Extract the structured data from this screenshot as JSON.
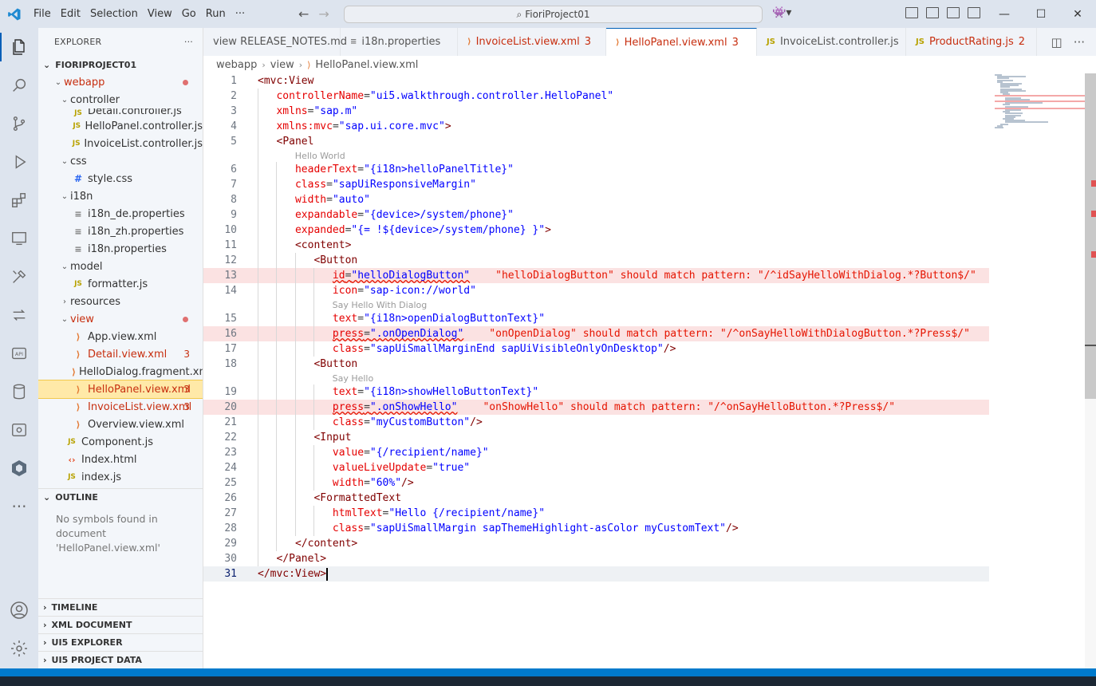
{
  "titlebar": {
    "menu": [
      "File",
      "Edit",
      "Selection",
      "View",
      "Go",
      "Run",
      "···"
    ],
    "search_text": "FioriProject01",
    "controls": {
      "minimize": "—",
      "maximize": "☐",
      "close": "✕"
    }
  },
  "explorer": {
    "title": "EXPLORER",
    "more": "···",
    "project": "FIORIPROJECT01",
    "tree": [
      {
        "label": "webapp",
        "type": "folder",
        "depth": 1,
        "error": true,
        "dot": true
      },
      {
        "label": "controller",
        "type": "folder",
        "depth": 2
      },
      {
        "label": "Detail.controller.js",
        "type": "js",
        "depth": 3,
        "partial": true
      },
      {
        "label": "HelloPanel.controller.js",
        "type": "js",
        "depth": 3
      },
      {
        "label": "InvoiceList.controller.js",
        "type": "js",
        "depth": 3
      },
      {
        "label": "css",
        "type": "folder",
        "depth": 2
      },
      {
        "label": "style.css",
        "type": "css",
        "depth": 3
      },
      {
        "label": "i18n",
        "type": "folder",
        "depth": 2
      },
      {
        "label": "i18n_de.properties",
        "type": "prop",
        "depth": 3
      },
      {
        "label": "i18n_zh.properties",
        "type": "prop",
        "depth": 3
      },
      {
        "label": "i18n.properties",
        "type": "prop",
        "depth": 3
      },
      {
        "label": "model",
        "type": "folder",
        "depth": 2
      },
      {
        "label": "formatter.js",
        "type": "js",
        "depth": 3
      },
      {
        "label": "resources",
        "type": "folder",
        "depth": 2,
        "collapsed": true
      },
      {
        "label": "view",
        "type": "folder",
        "depth": 2,
        "error": true,
        "dot": true
      },
      {
        "label": "App.view.xml",
        "type": "xml",
        "depth": 3
      },
      {
        "label": "Detail.view.xml",
        "type": "xml",
        "depth": 3,
        "error": true,
        "badge": "3"
      },
      {
        "label": "HelloDialog.fragment.xml",
        "type": "xml",
        "depth": 3
      },
      {
        "label": "HelloPanel.view.xml",
        "type": "xml",
        "depth": 3,
        "error": true,
        "badge": "3",
        "selected": true
      },
      {
        "label": "InvoiceList.view.xml",
        "type": "xml",
        "depth": 3,
        "error": true,
        "badge": "3"
      },
      {
        "label": "Overview.view.xml",
        "type": "xml",
        "depth": 3
      },
      {
        "label": "Component.js",
        "type": "js",
        "depth": 2
      },
      {
        "label": "Index.html",
        "type": "html",
        "depth": 2
      },
      {
        "label": "index.js",
        "type": "js",
        "depth": 2
      }
    ],
    "outline_title": "OUTLINE",
    "outline_msg": "No symbols found in document 'HelloPanel.view.xml'",
    "bottom_sections": [
      "TIMELINE",
      "XML DOCUMENT",
      "UI5 EXPLORER",
      "UI5 PROJECT DATA"
    ]
  },
  "tabs": [
    {
      "label": "view RELEASE_NOTES.md",
      "icon": "",
      "error": false
    },
    {
      "label": "i18n.properties",
      "icon": "prop",
      "error": false
    },
    {
      "label": "InvoiceList.view.xml",
      "icon": "xml",
      "error": true,
      "badge": "3"
    },
    {
      "label": "HelloPanel.view.xml",
      "icon": "xml",
      "error": true,
      "badge": "3",
      "active": true,
      "modified": true
    },
    {
      "label": "InvoiceList.controller.js",
      "icon": "js",
      "error": false
    },
    {
      "label": "ProductRating.js",
      "icon": "js",
      "error": true,
      "badge": "2"
    }
  ],
  "breadcrumb": [
    "webapp",
    "view",
    "HelloPanel.view.xml"
  ],
  "editor": {
    "lines": [
      {
        "n": "1",
        "html": "<span class=\"punc\">&lt;</span><span class=\"tag\">mvc:View</span>"
      },
      {
        "n": "2",
        "html": "   <span class=\"attr\">controllerName</span>=<span class=\"val\">\"ui5.walkthrough.controller.HelloPanel\"</span>"
      },
      {
        "n": "3",
        "html": "   <span class=\"attr\">xmlns</span>=<span class=\"val\">\"sap.m\"</span>"
      },
      {
        "n": "4",
        "html": "   <span class=\"attr\">xmlns:mvc</span>=<span class=\"val\">\"sap.ui.core.mvc\"</span><span class=\"punc\">&gt;</span>"
      },
      {
        "n": "5",
        "html": "   <span class=\"punc\">&lt;</span><span class=\"tag\">Panel</span>"
      },
      {
        "n": "6",
        "html": "      <span class=\"attr\">headerText</span>=<span class=\"val\">\"{i18n&gt;helloPanelTitle}\"</span>",
        "inlay": "Hello World"
      },
      {
        "n": "7",
        "html": "      <span class=\"attr\">class</span>=<span class=\"val\">\"sapUiResponsiveMargin\"</span>"
      },
      {
        "n": "8",
        "html": "      <span class=\"attr\">width</span>=<span class=\"val\">\"auto\"</span>"
      },
      {
        "n": "9",
        "html": "      <span class=\"attr\">expandable</span>=<span class=\"val\">\"{device&gt;/system/phone}\"</span>"
      },
      {
        "n": "10",
        "html": "      <span class=\"attr\">expanded</span>=<span class=\"val\">\"{= !${device&gt;/system/phone} }\"</span><span class=\"punc\">&gt;</span>"
      },
      {
        "n": "11",
        "html": "      <span class=\"punc\">&lt;</span><span class=\"tag\">content</span><span class=\"punc\">&gt;</span>"
      },
      {
        "n": "12",
        "html": "         <span class=\"punc\">&lt;</span><span class=\"tag\">Button</span>"
      },
      {
        "n": "13",
        "err": true,
        "html": "            <span class=\"squig\"><span class=\"attr\">id</span>=<span class=\"val\">\"helloDialogButton\"</span></span><span class=\"diag\">\"helloDialogButton\" should match pattern: \"/^idSayHelloWithDialog.*?Button$/\"</span>"
      },
      {
        "n": "14",
        "html": "            <span class=\"attr\">icon</span>=<span class=\"val\">\"sap-icon://world\"</span>"
      },
      {
        "n": "15",
        "html": "            <span class=\"attr\">text</span>=<span class=\"val\">\"{i18n&gt;openDialogButtonText}\"</span>",
        "inlay": "Say Hello With Dialog"
      },
      {
        "n": "16",
        "err": true,
        "html": "            <span class=\"squig\"><span class=\"attr\">press</span>=<span class=\"val\">\".onOpenDialog\"</span></span><span class=\"diag\">\"onOpenDialog\" should match pattern: \"/^onSayHelloWithDialogButton.*?Press$/\"</span>"
      },
      {
        "n": "17",
        "html": "            <span class=\"attr\">class</span>=<span class=\"val\">\"sapUiSmallMarginEnd sapUiVisibleOnlyOnDesktop\"</span><span class=\"punc\">/&gt;</span>"
      },
      {
        "n": "18",
        "html": "         <span class=\"punc\">&lt;</span><span class=\"tag\">Button</span>"
      },
      {
        "n": "19",
        "html": "            <span class=\"attr\">text</span>=<span class=\"val\">\"{i18n&gt;showHelloButtonText}\"</span>",
        "inlay": "Say Hello"
      },
      {
        "n": "20",
        "err": true,
        "html": "            <span class=\"squig\"><span class=\"attr\">press</span>=<span class=\"val\">\".onShowHello\"</span></span><span class=\"diag\">\"onShowHello\" should match pattern: \"/^onSayHelloButton.*?Press$/\"</span>"
      },
      {
        "n": "21",
        "html": "            <span class=\"attr\">class</span>=<span class=\"val\">\"myCustomButton\"</span><span class=\"punc\">/&gt;</span>"
      },
      {
        "n": "22",
        "html": "         <span class=\"punc\">&lt;</span><span class=\"tag\">Input</span>"
      },
      {
        "n": "23",
        "html": "            <span class=\"attr\">value</span>=<span class=\"val\">\"{/recipient/name}\"</span>"
      },
      {
        "n": "24",
        "html": "            <span class=\"attr\">valueLiveUpdate</span>=<span class=\"val\">\"true\"</span>"
      },
      {
        "n": "25",
        "html": "            <span class=\"attr\">width</span>=<span class=\"val\">\"60%\"</span><span class=\"punc\">/&gt;</span>"
      },
      {
        "n": "26",
        "html": "         <span class=\"punc\">&lt;</span><span class=\"tag\">FormattedText</span>"
      },
      {
        "n": "27",
        "html": "            <span class=\"attr\">htmlText</span>=<span class=\"val\">\"Hello {/recipient/name}\"</span>"
      },
      {
        "n": "28",
        "html": "            <span class=\"attr\">class</span>=<span class=\"val\">\"sapUiSmallMargin sapThemeHighlight-asColor myCustomText\"</span><span class=\"punc\">/&gt;</span>"
      },
      {
        "n": "29",
        "html": "      <span class=\"punc\">&lt;/</span><span class=\"tag\">content</span><span class=\"punc\">&gt;</span>"
      },
      {
        "n": "30",
        "html": "   <span class=\"punc\">&lt;/</span><span class=\"tag\">Panel</span><span class=\"punc\">&gt;</span>"
      },
      {
        "n": "31",
        "cur": true,
        "html": "<span class=\"punc\">&lt;/</span><span class=\"tag\">mvc:View</span><span class=\"punc\">&gt;</span><span class=\"cursor\"></span>"
      }
    ]
  },
  "colors": {
    "accent": "#005fb8",
    "error": "#e51400",
    "selection": "#ffe9a8",
    "statusbar": "#007acc"
  }
}
